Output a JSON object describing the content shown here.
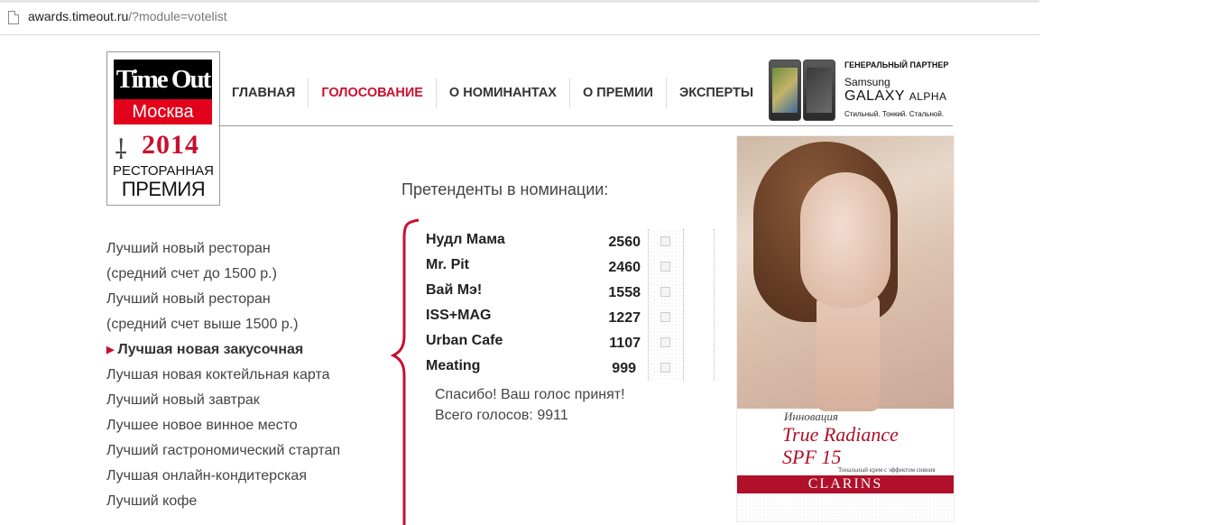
{
  "browser": {
    "url_domain": "awards.timeout.ru",
    "url_path": "/?module=votelist"
  },
  "logo": {
    "line1": "Time Out",
    "line2": "Москва",
    "year": "2014",
    "line3": "РЕСТОРАННАЯ",
    "line4": "ПРЕМИЯ"
  },
  "nav": {
    "items": [
      {
        "label": "ГЛАВНАЯ"
      },
      {
        "label": "ГОЛОСОВАНИЕ"
      },
      {
        "label": "О НОМИНАНТАХ"
      },
      {
        "label": "О ПРЕМИИ"
      },
      {
        "label": "ЭКСПЕРТЫ"
      }
    ]
  },
  "partner": {
    "title": "ГЕНЕРАЛЬНЫЙ ПАРТНЕР",
    "brand": "Samsung",
    "model_main": "GALAXY",
    "model_sub": "ALPHA",
    "tagline": "Стильный. Тонкий. Стальной."
  },
  "categories": [
    {
      "label": "Лучший новый ресторан"
    },
    {
      "label": "(средний счет до 1500 р.)"
    },
    {
      "label": "Лучший новый ресторан"
    },
    {
      "label": "(средний счет выше 1500 р.)"
    },
    {
      "label": "Лучшая новая закусочная"
    },
    {
      "label": "Лучшая новая коктейльная карта"
    },
    {
      "label": "Лучший новый завтрак"
    },
    {
      "label": "Лучшее новое винное место"
    },
    {
      "label": "Лучший гастрономический стартап"
    },
    {
      "label": "Лучшая онлайн-кондитерская"
    },
    {
      "label": "Лучший кофе"
    }
  ],
  "contenders": {
    "title": "Претенденты в номинации:",
    "rows": [
      {
        "name": "Нудл Мама",
        "votes": "2560"
      },
      {
        "name": "Mr. Pit",
        "votes": "2460"
      },
      {
        "name": "Вай Мэ!",
        "votes": "1558"
      },
      {
        "name": "ISS+MAG",
        "votes": "1227"
      },
      {
        "name": "Urban Cafe",
        "votes": "1107"
      },
      {
        "name": "Meating",
        "votes": "999"
      }
    ],
    "thanks": "Спасибо! Ваш голос принят!",
    "total": "Всего голосов: 9911"
  },
  "ad": {
    "innovation": "Инновация",
    "product_line1": "True Radiance",
    "product_line2": "SPF 15",
    "subtitle": "Тональный крем с эффектом сияния",
    "brand": "CLARINS"
  },
  "colors": {
    "accent": "#c8102e",
    "logo_red": "#e2001a",
    "ad_red": "#b0102a"
  }
}
